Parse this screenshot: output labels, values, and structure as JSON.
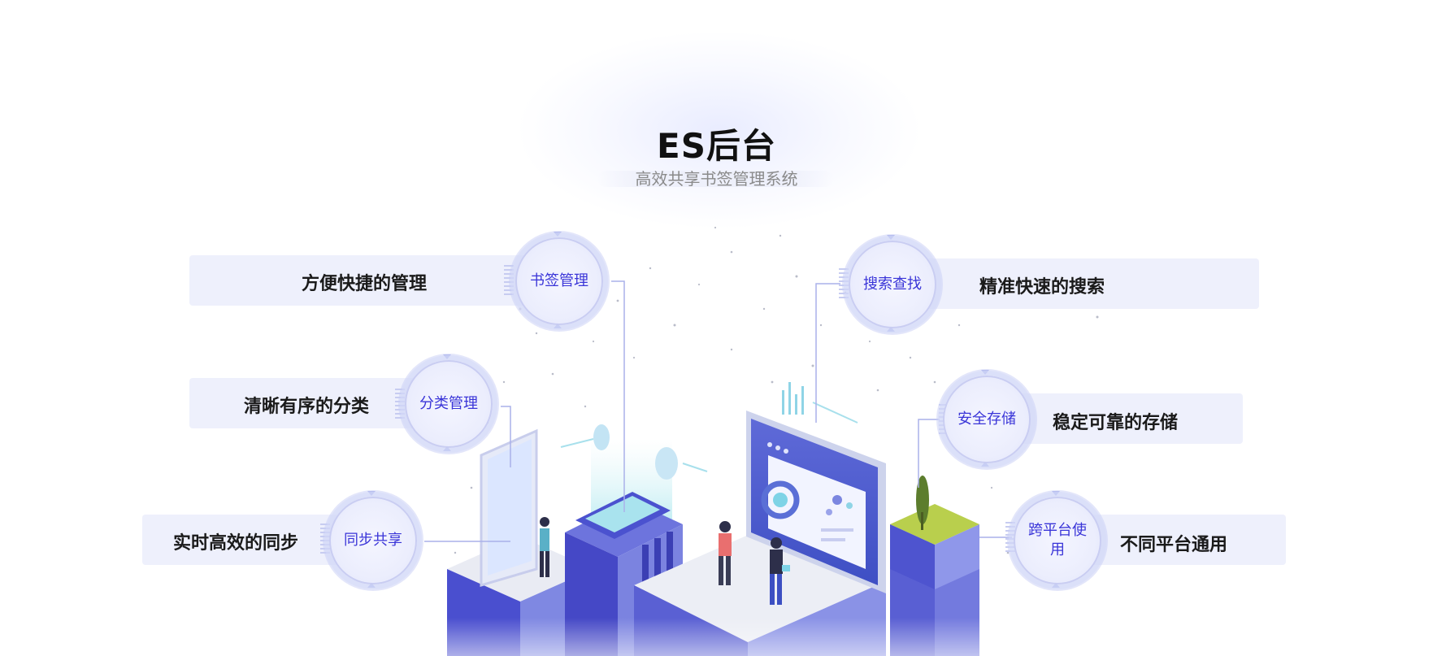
{
  "header": {
    "title": "ES后台",
    "subtitle": "高效共享书签管理系统"
  },
  "features": [
    {
      "label": "书签管理",
      "description": "方便快捷的管理"
    },
    {
      "label": "分类管理",
      "description": "清晰有序的分类"
    },
    {
      "label": "同步共享",
      "description": "实时高效的同步"
    },
    {
      "label": "搜索查找",
      "description": "精准快速的搜索"
    },
    {
      "label": "安全存储",
      "description": "稳定可靠的存储"
    },
    {
      "label": "跨平台使用",
      "description": "不同平台通用"
    }
  ],
  "colors": {
    "accent": "#3a35d8",
    "bar_background": "#eef0fc",
    "illustration_primary": "#4a4fcf",
    "illustration_light": "#8d95e6"
  }
}
